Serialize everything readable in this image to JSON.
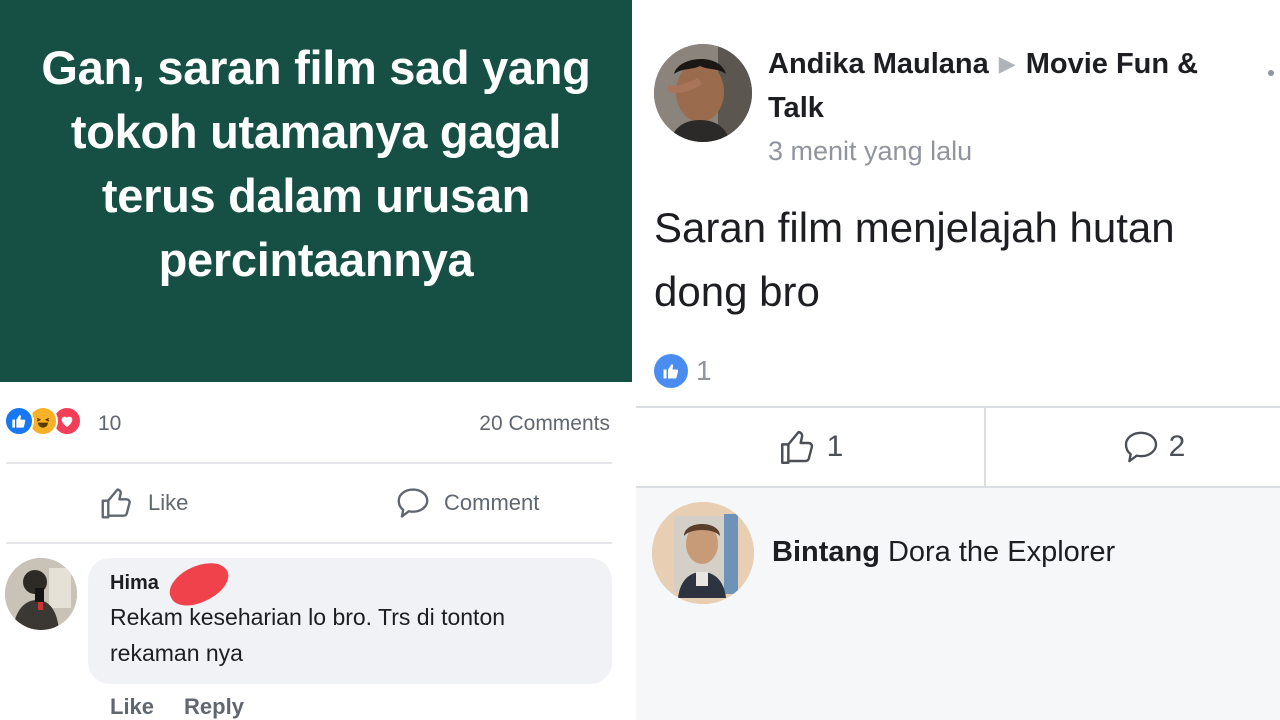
{
  "left_post": {
    "banner_text": "Gan, saran film sad yang tokoh utamanya gagal terus dalam urusan percintaannya",
    "banner_color": "#165045",
    "reaction_icons": [
      "like-icon",
      "haha-icon",
      "love-icon"
    ],
    "reaction_count": "10",
    "comments_count": "20 Comments",
    "like_label": "Like",
    "comment_label": "Comment",
    "comment": {
      "author": "Hima",
      "text": "Rekam keseharian lo bro. Trs di tonton rekaman nya",
      "like_label": "Like",
      "reply_label": "Reply"
    }
  },
  "right_post": {
    "author": "Andika Maulana",
    "group": "Movie Fun & Talk",
    "time": "3 menit yang lalu",
    "text": "Saran film menjelajah hutan dong bro",
    "like_summary_count": "1",
    "like_count": "1",
    "comment_count": "2",
    "reply": {
      "author": "Bintang",
      "text": "Dora the Explorer"
    }
  },
  "colors": {
    "facebook_blue": "#1877f2",
    "text_secondary": "#606770"
  }
}
